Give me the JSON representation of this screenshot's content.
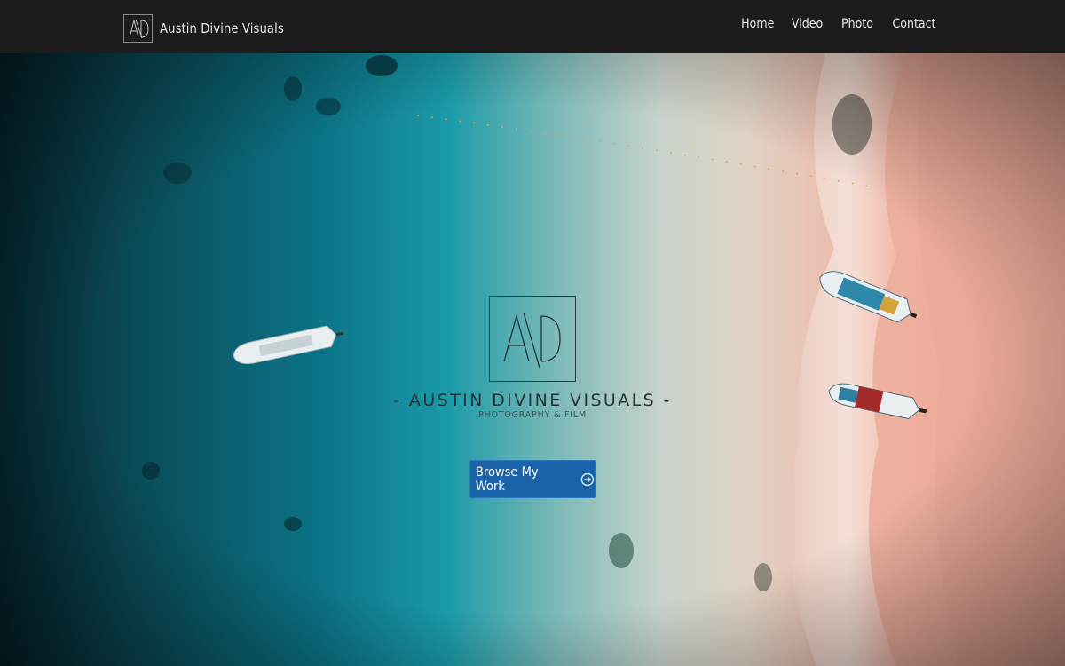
{
  "header": {
    "brand_name": "Austin Divine Visuals",
    "logo_mark": "A\\D",
    "nav": [
      {
        "label": "Home"
      },
      {
        "label": "Video"
      },
      {
        "label": "Photo"
      },
      {
        "label": "Contact"
      }
    ]
  },
  "hero": {
    "title": "- AUSTIN DIVINE VISUALS -",
    "subtitle": "PHOTOGRAPHY & FILM",
    "cta_label": "Browse My Work",
    "cta_icon": "circle-arrow-right-icon",
    "background_image": "aerial-beach-boats-photo"
  },
  "colors": {
    "navbar": "#1c1c1c",
    "cta_button": "#1a63a8",
    "ocean": "#0e6f80",
    "sand": "#efb1a2"
  }
}
